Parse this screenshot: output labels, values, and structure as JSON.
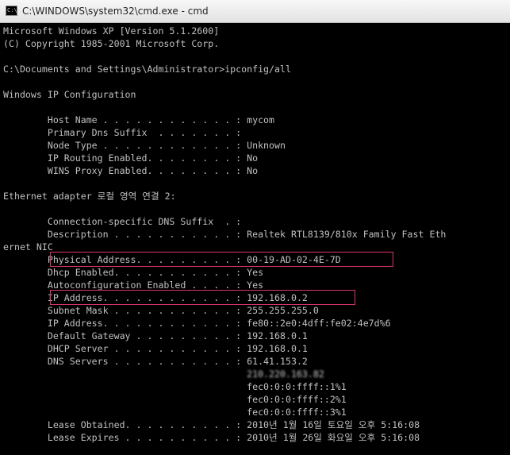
{
  "window": {
    "title": "C:\\WINDOWS\\system32\\cmd.exe - cmd",
    "icon_label": "C:\\"
  },
  "console": {
    "lines": [
      "Microsoft Windows XP [Version 5.1.2600]",
      "(C) Copyright 1985-2001 Microsoft Corp.",
      "",
      "C:\\Documents and Settings\\Administrator>ipconfig/all",
      "",
      "Windows IP Configuration",
      "",
      "        Host Name . . . . . . . . . . . . : mycom",
      "        Primary Dns Suffix  . . . . . . . :",
      "        Node Type . . . . . . . . . . . . : Unknown",
      "        IP Routing Enabled. . . . . . . . : No",
      "        WINS Proxy Enabled. . . . . . . . : No",
      "",
      "Ethernet adapter 로컬 영역 연결 2:",
      "",
      "        Connection-specific DNS Suffix  . :",
      "        Description . . . . . . . . . . . : Realtek RTL8139/810x Family Fast Eth",
      "ernet NIC",
      "        Physical Address. . . . . . . . . : 00-19-AD-02-4E-7D",
      "        Dhcp Enabled. . . . . . . . . . . : Yes",
      "        Autoconfiguration Enabled . . . . : Yes",
      "        IP Address. . . . . . . . . . . . : 192.168.0.2",
      "        Subnet Mask . . . . . . . . . . . : 255.255.255.0",
      "        IP Address. . . . . . . . . . . . : fe80::2e0:4dff:fe02:4e7d%6",
      "        Default Gateway . . . . . . . . . : 192.168.0.1",
      "        DHCP Server . . . . . . . . . . . : 192.168.0.1",
      "        DNS Servers . . . . . . . . . . . : 61.41.153.2",
      "                                            210.220.163.82",
      "                                            fec0:0:0:ffff::1%1",
      "                                            fec0:0:0:ffff::2%1",
      "                                            fec0:0:0:ffff::3%1",
      "        Lease Obtained. . . . . . . . . . : 2010년 1월 16일 토요일 오후 5:16:08",
      "        Lease Expires . . . . . . . . . . : 2010년 1월 26일 화요일 오후 5:16:08"
    ]
  },
  "colors": {
    "console_background": "#000000",
    "console_text": "#c0c0c0",
    "highlight_border": "#d9346f"
  }
}
